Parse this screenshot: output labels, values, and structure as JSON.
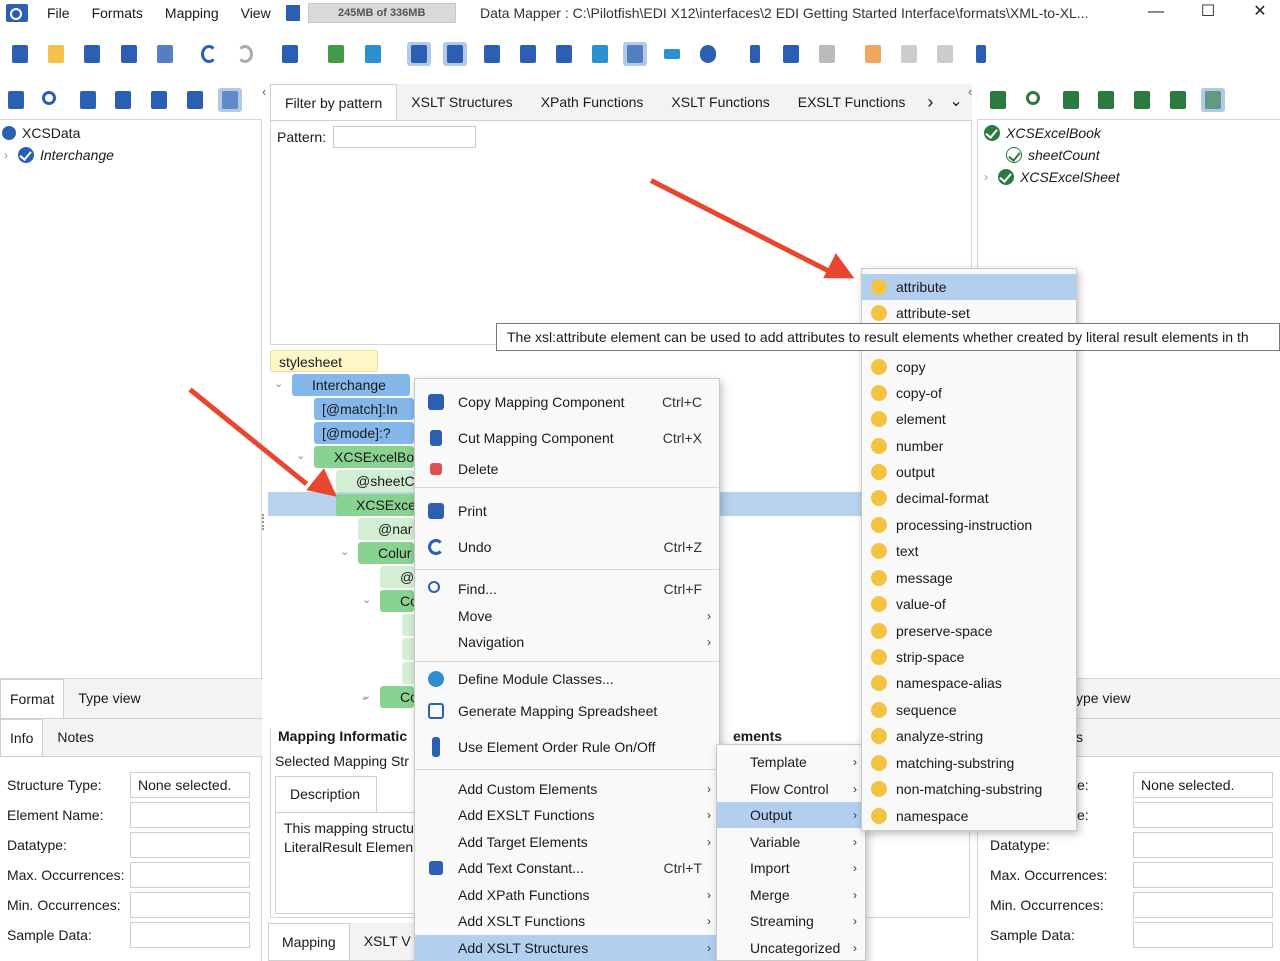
{
  "titlebar": {
    "menus": [
      "File",
      "Formats",
      "Mapping",
      "View"
    ],
    "memory": "245MB of 336MB",
    "title": "Data Mapper : C:\\Pilotfish\\EDI X12\\interfaces\\2 EDI Getting Started Interface\\formats\\XML-to-XL...",
    "minimize": "—",
    "maximize": "☐",
    "close": "✕"
  },
  "left_tree": {
    "root": "XCSData",
    "child": "Interchange"
  },
  "right_tree": {
    "root": "XCSExcelBook",
    "child1": "sheetCount",
    "child2": "XCSExcelSheet"
  },
  "center_tabs": [
    "Filter by pattern",
    "XSLT Structures",
    "XPath Functions",
    "XSLT Functions",
    "EXSLT Functions"
  ],
  "center_more": "›",
  "center_dropdown": "⌄",
  "filter": {
    "pattern_label": "Pattern:",
    "pattern_value": ""
  },
  "mapping_nodes": [
    "stylesheet",
    "Interchange",
    "[@match]:In",
    "[@mode]:?",
    "XCSExcelBoo",
    "@sheetC",
    "XCSExcel",
    "@nar",
    "Colur",
    "@",
    "Co",
    "Co"
  ],
  "left_bottom": {
    "tabs1": [
      "Format",
      "Type view"
    ],
    "tabs2": [
      "Info",
      "Notes"
    ],
    "labels": [
      "Structure Type:",
      "Element Name:",
      "Datatype:",
      "Max. Occurrences:",
      "Min. Occurrences:",
      "Sample Data:"
    ],
    "structure_value": "None selected."
  },
  "right_bottom": {
    "tab1": "ype view",
    "tab2": "s",
    "labels": [
      "e:",
      "e:",
      "Datatype:",
      "Max. Occurrences:",
      "Min. Occurrences:",
      "Sample Data:"
    ],
    "structure_value": "None selected."
  },
  "mapping_info": {
    "title": "Mapping Informatic",
    "selected": "Selected Mapping Str",
    "desc_tab": "Description",
    "desc_line1": "This mapping structu",
    "desc_line2": "LiteralResult Elemen",
    "elements_label": "ements"
  },
  "bottom_tabs": [
    "Mapping",
    "XSLT V"
  ],
  "context_menu": [
    {
      "label": "Copy Mapping Component",
      "shortcut": "Ctrl+C"
    },
    {
      "label": "Cut Mapping Component",
      "shortcut": "Ctrl+X"
    },
    {
      "label": "Delete",
      "shortcut": ""
    },
    {
      "label": "Print",
      "shortcut": ""
    },
    {
      "label": "Undo",
      "shortcut": "Ctrl+Z"
    },
    {
      "label": "Find...",
      "shortcut": "Ctrl+F"
    },
    {
      "label": "Move",
      "shortcut": ""
    },
    {
      "label": "Navigation",
      "shortcut": ""
    },
    {
      "label": "Define Module Classes...",
      "shortcut": ""
    },
    {
      "label": "Generate Mapping Spreadsheet",
      "shortcut": ""
    },
    {
      "label": "Use Element Order Rule On/Off",
      "shortcut": ""
    },
    {
      "label": "Add Custom Elements",
      "shortcut": ""
    },
    {
      "label": "Add EXSLT Functions",
      "shortcut": ""
    },
    {
      "label": "Add Target Elements",
      "shortcut": ""
    },
    {
      "label": "Add Text Constant...",
      "shortcut": "Ctrl+T"
    },
    {
      "label": "Add XPath Functions",
      "shortcut": ""
    },
    {
      "label": "Add XSLT Functions",
      "shortcut": ""
    },
    {
      "label": "Add XSLT Structures",
      "shortcut": ""
    }
  ],
  "submenu": [
    "Template",
    "Flow Control",
    "Output",
    "Variable",
    "Import",
    "Merge",
    "Streaming",
    "Uncategorized"
  ],
  "output_menu": [
    "attribute",
    "attribute-set",
    "copy",
    "copy-of",
    "element",
    "number",
    "output",
    "decimal-format",
    "processing-instruction",
    "text",
    "message",
    "value-of",
    "preserve-space",
    "strip-space",
    "namespace-alias",
    "sequence",
    "analyze-string",
    "matching-substring",
    "non-matching-substring",
    "namespace"
  ],
  "tooltip": "The xsl:attribute element can be used to add attributes to result elements whether created by literal result elements in th",
  "arrow_glyph": "›",
  "colors": {
    "accent": "#2b5fb4",
    "highlight": "#b2cff0",
    "arrow": "#e8462d",
    "node_blue": "#84b7ea",
    "node_green": "#88d38f",
    "output_dot": "#f5c342"
  }
}
